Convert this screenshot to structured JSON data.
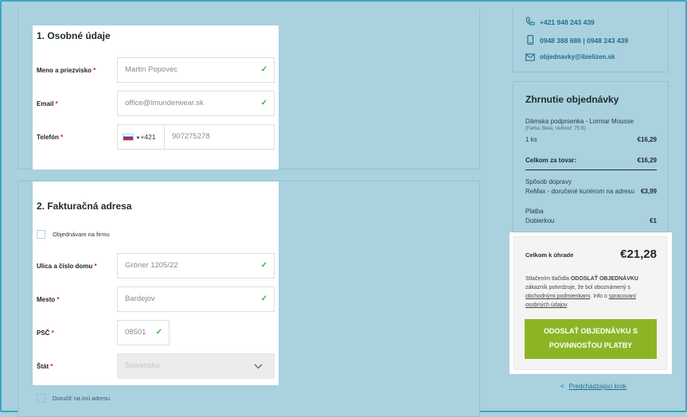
{
  "contacts": [
    {
      "icon": "phone-icon",
      "text": "+421 948 243 439"
    },
    {
      "icon": "mobile-icon",
      "text": "0948 388 686 | 0948 243 439"
    },
    {
      "icon": "mail-icon",
      "text": "objednavky@ibielizen.sk"
    }
  ],
  "personal": {
    "title": "1. Osobné údaje",
    "name_label": "Meno a priezvisko",
    "name_value": "Martin Popovec",
    "email_label": "Email",
    "email_value": "office@lmunderwear.sk",
    "phone_label": "Telefón",
    "phone_prefix": "+421",
    "phone_value": "907275278",
    "required_mark": "*"
  },
  "billing": {
    "title": "2. Fakturačná adresa",
    "company_checkbox": "Objednávam na firmu",
    "street_label": "Ulica a číslo domu",
    "street_value": "Gróner 1205/22",
    "city_label": "Mesto",
    "city_value": "Bardejov",
    "zip_label": "PSČ",
    "zip_value": "08501",
    "country_label": "Štát",
    "country_value": "Slovensko",
    "other_address_checkbox": "Doručiť na inú adresu"
  },
  "summary": {
    "title": "Zhrnutie objednávky",
    "item_name": "Dámska podprsenka - Lormar Mousse",
    "item_details": "(Farba: Biela, Veľkosť: 75 B)",
    "item_qty": "1 ks",
    "item_price": "€16,29",
    "goods_total_label": "Celkom za tovar:",
    "goods_total": "€16,29",
    "shipping_label": "Spôsob dopravy",
    "shipping_method": "ReMax - doručené kuriérom na adresu",
    "shipping_price": "€3,99",
    "payment_label": "Platba",
    "payment_method": "Dobierkou",
    "payment_price": "€1",
    "total_label": "Celkom k úhrade",
    "total": "€21,28",
    "consent_1": "Stlačením tlačidla ",
    "consent_bold": "ODOSLAŤ OBJEDNÁVKU",
    "consent_2": " zákazník potvrdzuje, že bol oboznámený s ",
    "consent_link1": "obchodnými podmienkami",
    "consent_3": ". Info o ",
    "consent_link2": "spracovaní osobných údajov",
    "consent_4": ".",
    "submit_line1": "ODOSLAŤ OBJEDNÁVKU S",
    "submit_line2": "POVINNOSŤOU PLATBY",
    "back_arrow": "<",
    "back_link": "Predchádzajúci krok"
  },
  "colors": {
    "accent": "#8cb526",
    "link": "#1e6f8e",
    "background": "#a9d1de",
    "check": "#3bb13b"
  }
}
